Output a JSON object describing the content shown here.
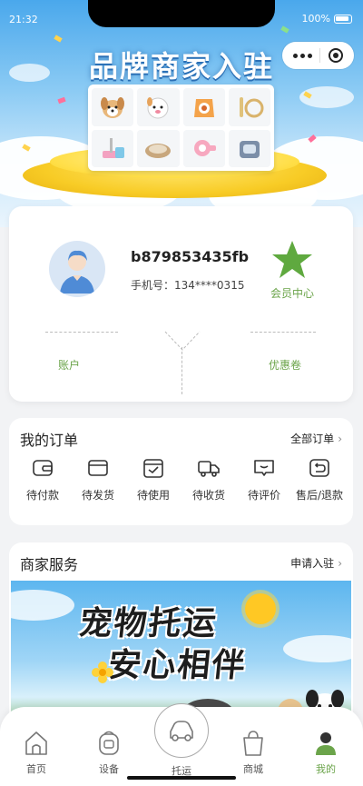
{
  "status": {
    "time": "21:32",
    "battery": "100%"
  },
  "banner": {
    "title": "品牌商家入驻"
  },
  "profile": {
    "username": "b879853435fb",
    "phone_label": "手机号：",
    "phone": "134****0315",
    "member_center": "会员中心",
    "account": "账户",
    "coupon": "优惠卷"
  },
  "orders": {
    "title": "我的订单",
    "all_link": "全部订单",
    "items": [
      {
        "label": "待付款",
        "icon": "wallet-icon"
      },
      {
        "label": "待发货",
        "icon": "card-icon"
      },
      {
        "label": "待使用",
        "icon": "ticket-check-icon"
      },
      {
        "label": "待收货",
        "icon": "truck-icon"
      },
      {
        "label": "待评价",
        "icon": "comment-icon"
      },
      {
        "label": "售后/退款",
        "icon": "return-icon"
      }
    ]
  },
  "merchant": {
    "title": "商家服务",
    "apply_link": "申请入驻",
    "banner_line1": "宠物托运",
    "banner_line2": "安心相伴"
  },
  "tabbar": {
    "items": [
      {
        "label": "首页",
        "icon": "home-icon"
      },
      {
        "label": "设备",
        "icon": "device-icon"
      },
      {
        "label": "托运",
        "icon": "car-icon"
      },
      {
        "label": "商城",
        "icon": "shopping-bag-icon"
      },
      {
        "label": "我的",
        "icon": "user-icon"
      }
    ],
    "active": "我的"
  },
  "colors": {
    "accent": "#6ba44a",
    "background": "#f2f3f5",
    "banner_sky": "#4aa8ec",
    "star": "#5fa93f"
  }
}
